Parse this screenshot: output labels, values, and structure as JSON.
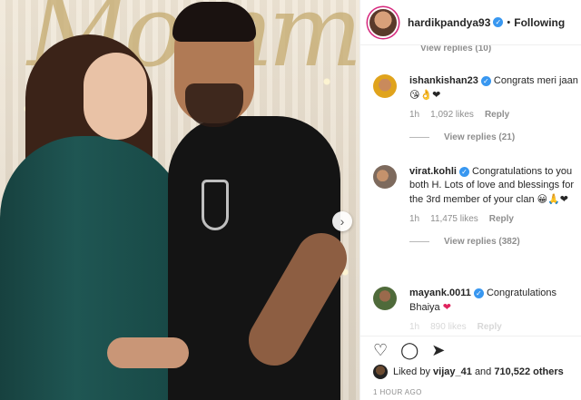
{
  "post": {
    "username": "hardikpandya93",
    "separator": "•",
    "follow_status": "Following",
    "verified_glyph": "✓"
  },
  "photo": {
    "next_glyph": "›"
  },
  "comments": {
    "top_replies": "View replies (10)",
    "items": [
      {
        "user": "ishankishan23",
        "text": "Congrats meri jaan",
        "emojis": "😘👌❤",
        "time": "1h",
        "likes": "1,092 likes",
        "reply": "Reply",
        "replies": "View replies (21)"
      },
      {
        "user": "virat.kohli",
        "text": "Congratulations to you both H. Lots of love and blessings for the 3rd member of your clan",
        "emojis": "😀🙏❤",
        "time": "1h",
        "likes": "11,475 likes",
        "reply": "Reply",
        "replies": "View replies (382)"
      },
      {
        "user": "mayank.0011",
        "text": "Congratulations Bhaiya",
        "emojis": "❤",
        "time": "1h",
        "likes": "890 likes",
        "reply": "Reply"
      }
    ]
  },
  "actions": {
    "like_icon": "♡",
    "comment_icon": "◯",
    "share_icon": "➤"
  },
  "likes": {
    "prefix": "Liked by",
    "user": "vijay_41",
    "conj": "and",
    "others": "710,522 others"
  },
  "timestamp": "1 HOUR AGO",
  "colors": {
    "verified": "#3897f0",
    "heart": "#e0245e",
    "muted": "#8e8e8e"
  }
}
